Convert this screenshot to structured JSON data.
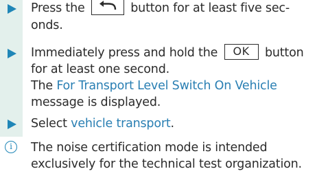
{
  "steps": [
    {
      "lines": [
        {
          "pre": "Press the ",
          "key": "back-arrow",
          "post": " button for at least five sec-"
        },
        {
          "text": "onds."
        }
      ]
    },
    {
      "lines": [
        {
          "pre": "Immediately press and hold the ",
          "key_label": "OK",
          "post": " button"
        },
        {
          "text": "for at least one second."
        },
        {
          "pre": "The ",
          "link": "For Transport Level Switch On Vehicle"
        },
        {
          "text": "message is displayed."
        }
      ]
    },
    {
      "lines": [
        {
          "pre": "Select ",
          "link": "vehicle transport",
          "post": "."
        }
      ]
    }
  ],
  "note": {
    "icon": "info-icon",
    "glyph": "i",
    "lines": [
      "The noise certification mode is intended",
      "exclusively for the technical test organization."
    ]
  },
  "colors": {
    "band": "#e3f0ec",
    "arrow": "#1f86b7",
    "link": "#2a7fb3",
    "text": "#2b2b2b"
  }
}
